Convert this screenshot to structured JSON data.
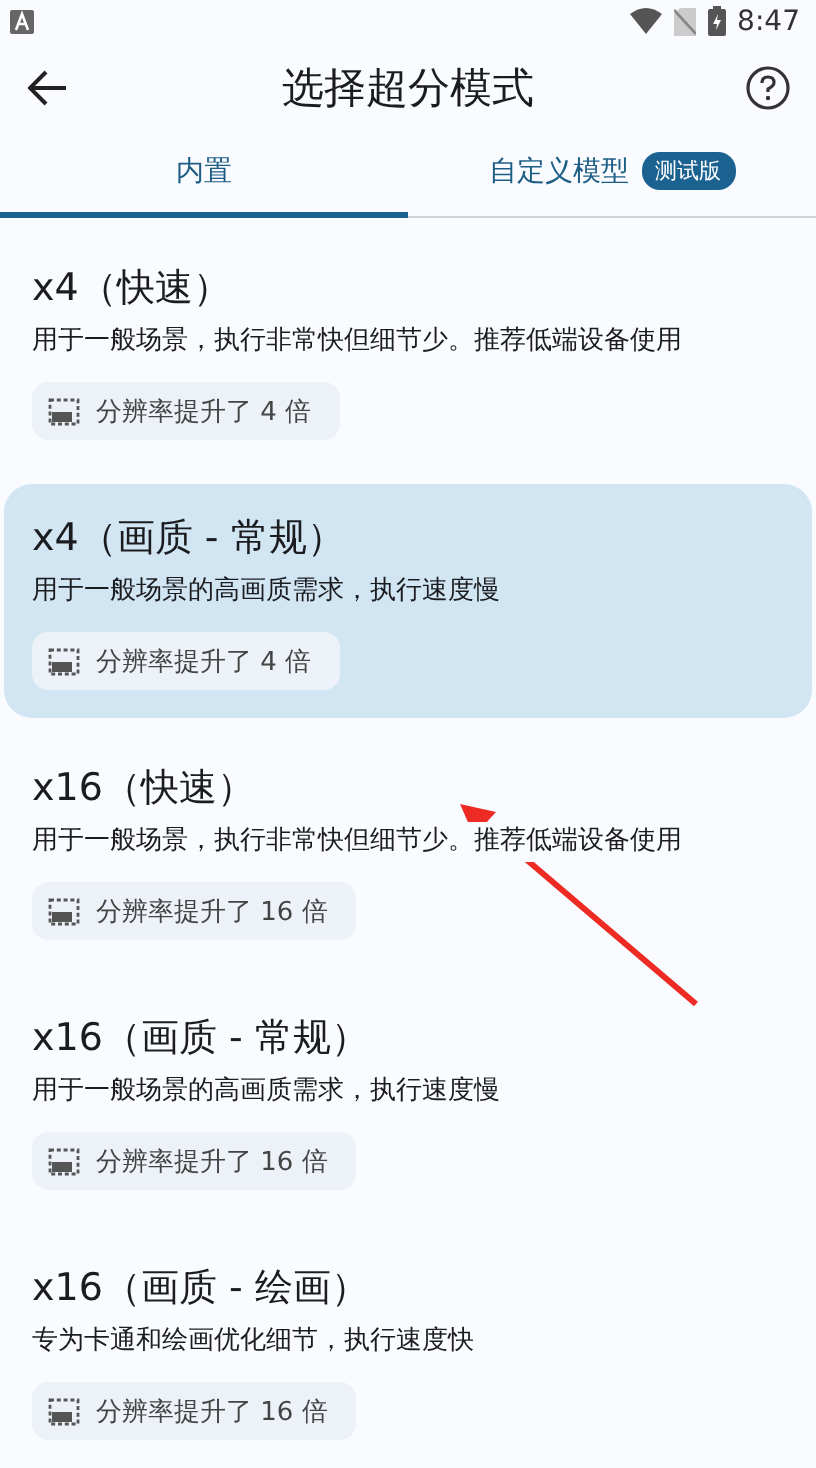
{
  "status_bar": {
    "time": "8:47"
  },
  "app_bar": {
    "title": "选择超分模式"
  },
  "tabs": [
    {
      "label": "内置",
      "selected": true
    },
    {
      "label": "自定义模型",
      "selected": false,
      "badge": "测试版"
    }
  ],
  "modes": [
    {
      "title": "x4（快速）",
      "description": "用于一般场景，执行非常快但细节少。推荐低端设备使用",
      "chip": "分辨率提升了 4 倍",
      "selected": false
    },
    {
      "title": "x4（画质 - 常规）",
      "description": "用于一般场景的高画质需求，执行速度慢",
      "chip": "分辨率提升了 4 倍",
      "selected": true
    },
    {
      "title": "x16（快速）",
      "description": "用于一般场景，执行非常快但细节少。推荐低端设备使用",
      "chip": "分辨率提升了 16 倍",
      "selected": false
    },
    {
      "title": "x16（画质 - 常规）",
      "description": "用于一般场景的高画质需求，执行速度慢",
      "chip": "分辨率提升了 16 倍",
      "selected": false
    },
    {
      "title": "x16（画质 - 绘画）",
      "description": "专为卡通和绘画优化细节，执行速度快",
      "chip": "分辨率提升了 16 倍",
      "selected": false
    }
  ]
}
